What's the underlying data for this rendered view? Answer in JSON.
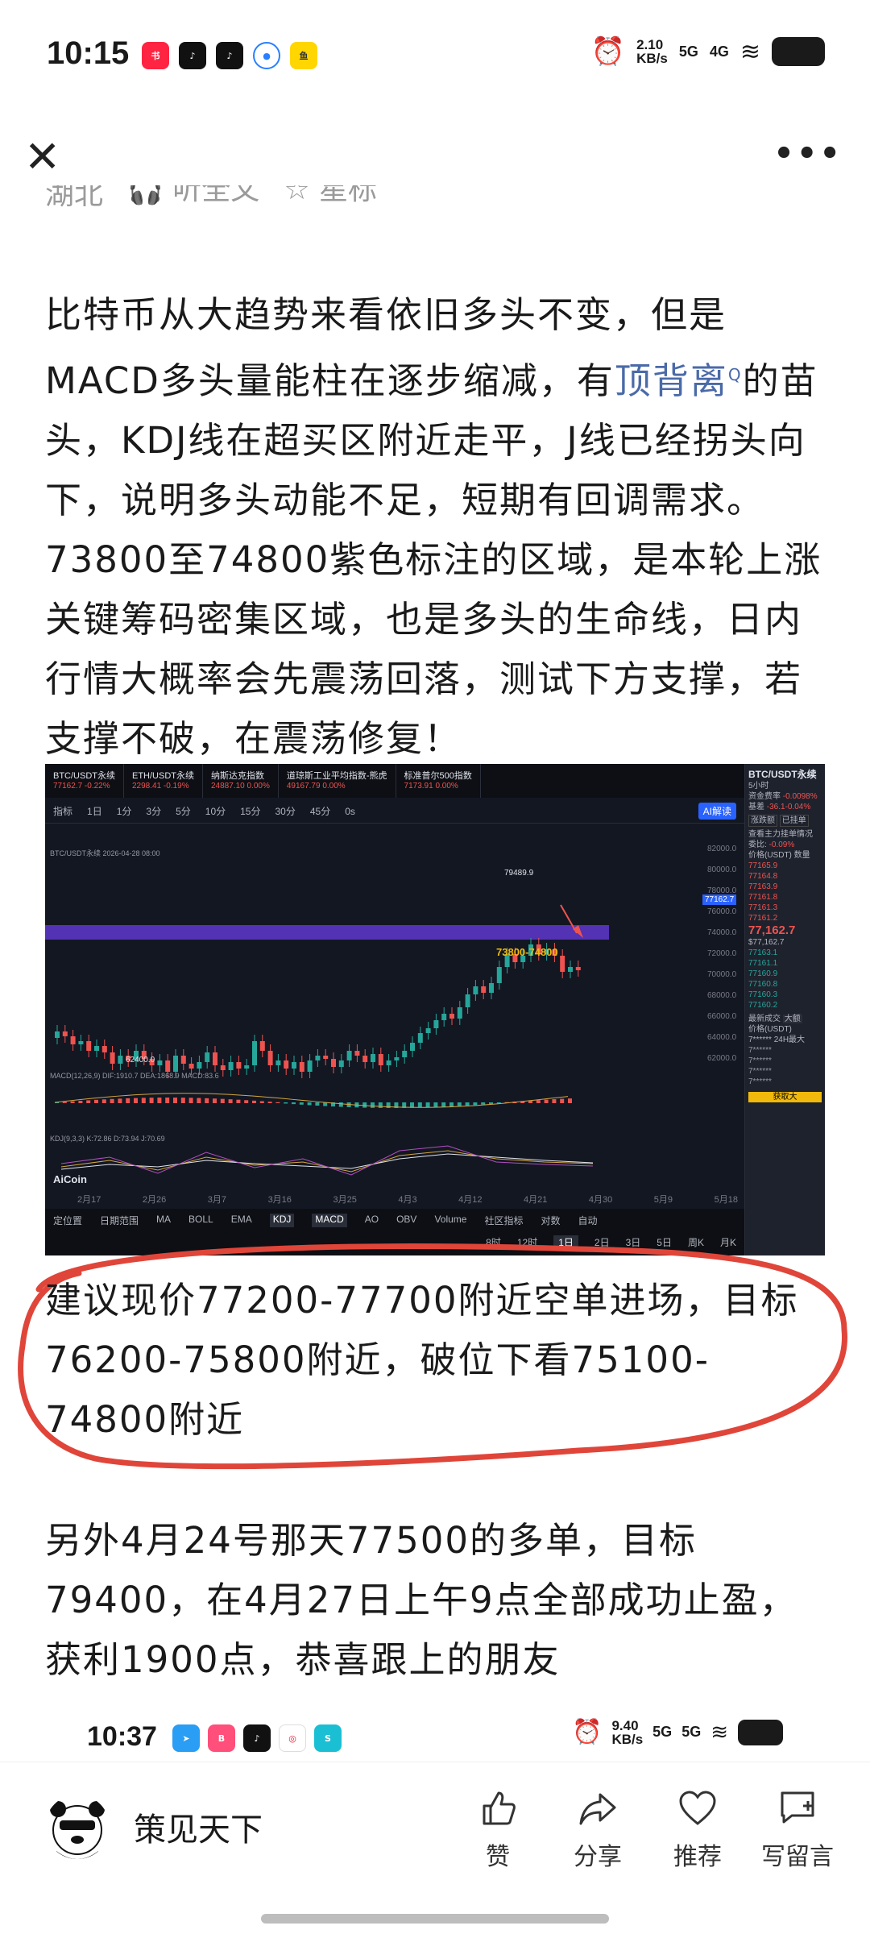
{
  "status_bar": {
    "time": "10:15",
    "net_speed": "2.10",
    "net_unit": "KB/s",
    "sig1": "5G",
    "sig2": "4G"
  },
  "meta": {
    "location": "湖北",
    "listen": "听全文",
    "star": "星标"
  },
  "article": {
    "p1_a": "比特币从大趋势来看依旧多头不变，但是MACD多头量能柱在逐步缩减，有",
    "p1_link": "顶背离",
    "p1_b": "的苗头，KDJ线在超买区附近走平，J线已经拐头向下，说明多头动能不足，短期有回调需求。73800至74800紫色标注的区域，是本轮上涨关键筹码密集区域，也是多头的生命线，日内行情大概率会先震荡回落，测试下方支撑，若支撑不破，在震荡修复！",
    "p2": "建议现价77200-77700附近空单进场，目标76200-75800附近，破位下看75100-74800附近",
    "p3": "另外4月24号那天77500的多单，目标79400，在4月27日上午9点全部成功止盈，获利1900点，恭喜跟上的朋友"
  },
  "chart": {
    "tabs": [
      {
        "name": "BTC/USDT永续",
        "value": "77162.7 -0.22%"
      },
      {
        "name": "ETH/USDT永续",
        "value": "2298.41 -0.19%"
      },
      {
        "name": "纳斯达克指数",
        "value": "24887.10 0.00%"
      },
      {
        "name": "道琼斯工业平均指数-熊虎",
        "value": "49167.79 0.00%"
      },
      {
        "name": "标准普尔500指数",
        "value": "7173.91 0.00%"
      }
    ],
    "toolbar": [
      "指标",
      "1日",
      "1分",
      "3分",
      "5分",
      "10分",
      "15分",
      "30分",
      "45分",
      "0s"
    ],
    "ai_label": "AI解读",
    "info_line": "BTC/USDT永续 2026-04-28 08:00",
    "zone_label": "73800-74800",
    "high_label": "79489.9",
    "low_label": "62400.0",
    "price_tag": "77162.7",
    "yaxis": [
      "82000.0",
      "80000.0",
      "78000.0",
      "76000.0",
      "74000.0",
      "72000.0",
      "70000.0",
      "68000.0",
      "66000.0",
      "64000.0",
      "62000.0"
    ],
    "xaxis": [
      "2月17",
      "2月26",
      "3月7",
      "3月16",
      "3月25",
      "4月3",
      "4月12",
      "4月21",
      "4月30",
      "5月9",
      "5月18"
    ],
    "macd_label": "MACD(12,26,9)  DIF:1910.7  DEA:1868.9  MACD:83.6",
    "kdj_label": "KDJ(9,3,3)  K:72.86  D:73.94  J:70.69",
    "logo": "AiCoin",
    "bottom_row1": [
      "定位置",
      "日期范围",
      "MA",
      "BOLL",
      "EMA",
      "KDJ",
      "MACD",
      "AO",
      "OBV",
      "Volume",
      "社区指标",
      "对数",
      "自动"
    ],
    "bottom_row2": [
      "8时",
      "12时",
      "1日",
      "2日",
      "3日",
      "5日",
      "周K",
      "月K"
    ],
    "side_title": "BTC/USDT永续",
    "side_sub": "5小时",
    "side_rate_label": "资金费率",
    "side_rate": "-0.0098%",
    "side_basis_label": "基差",
    "side_basis": "-36.1-0.04%",
    "side_buttons": [
      "涨跌额",
      "已挂单"
    ],
    "side_ob_title": "查看主力挂单情况",
    "side_ob_ratio_label": "委比:",
    "side_ob_ratio": "-0.09%",
    "side_price_label": "价格(USDT)",
    "side_qty_label": "数量",
    "side_asks": [
      "77165.9",
      "77164.8",
      "77163.9",
      "77161.8",
      "77161.3",
      "77161.2"
    ],
    "side_last": "77,162.7",
    "side_last_sub": "$77,162.7",
    "side_bids": [
      "77163.1",
      "77161.1",
      "77160.9",
      "77160.8",
      "77160.3",
      "77160.2"
    ],
    "side_trades_title": "最新成交",
    "side_trades_btn": "大额",
    "side_trades_price": "价格(USDT)",
    "side_trades_row": "7****** 24H最大",
    "side_fetch": "获取大"
  },
  "status_bar2": {
    "time": "10:37",
    "net_speed": "9.40",
    "net_unit": "KB/s",
    "sig1": "5G",
    "sig2": "5G"
  },
  "bottom": {
    "author": "策见天下",
    "actions": [
      {
        "label": "赞",
        "icon": "thumbs-up-icon"
      },
      {
        "label": "分享",
        "icon": "share-icon"
      },
      {
        "label": "推荐",
        "icon": "heart-icon"
      },
      {
        "label": "写留言",
        "icon": "comment-icon"
      }
    ]
  },
  "colors": {
    "link": "#4a6aa8",
    "circle": "#e0453a",
    "zone": "#6a3fd0",
    "bull": "#26a69a",
    "bear": "#ef5350"
  }
}
